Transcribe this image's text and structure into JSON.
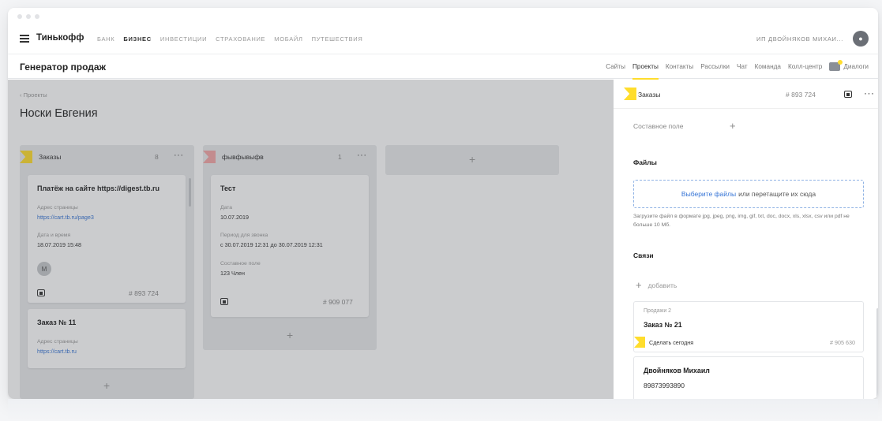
{
  "topbar": {
    "brand": "Тинькофф",
    "menu": [
      {
        "label": "БАНК",
        "active": false
      },
      {
        "label": "БИЗНЕС",
        "active": true
      },
      {
        "label": "ИНВЕСТИЦИИ",
        "active": false
      },
      {
        "label": "СТРАХОВАНИЕ",
        "active": false
      },
      {
        "label": "МОБАЙЛ",
        "active": false
      },
      {
        "label": "ПУТЕШЕСТВИЯ",
        "active": false
      }
    ],
    "account": "ИП ДВОЙНЯКОВ МИХАИ..."
  },
  "app": {
    "title": "Генератор продаж",
    "nav": [
      "Сайты",
      "Проекты",
      "Контакты",
      "Рассылки",
      "Чат",
      "Команда",
      "Колл-центр"
    ],
    "nav_active": "Проекты",
    "dialogs": "Диалоги"
  },
  "board": {
    "breadcrumb": "Проекты",
    "title": "Носки Евгения",
    "columns": [
      {
        "title": "Заказы",
        "count": "8",
        "flag_color": "#ffdd2d",
        "cards": [
          {
            "title": "Платёж на сайте https://digest.tb.ru",
            "page_label": "Адрес страницы",
            "page_url": "https://cart.tb.ru/page3",
            "date_label": "Дата и время",
            "date": "18.07.2019 15:48",
            "avatar": "М",
            "id": "# 893 724"
          },
          {
            "title": "Заказ № 11",
            "page_label": "Адрес страницы",
            "page_url": "https://cart.tb.ru"
          }
        ]
      },
      {
        "title": "фывфывыфв",
        "count": "1",
        "flag_color": "#f4a7a7",
        "cards": [
          {
            "title": "Тест",
            "date_label": "Дата",
            "date": "10.07.2019",
            "period_label": "Период для звонка",
            "period": "с 30.07.2019 12:31 до 30.07.2019 12:31",
            "field_label": "Составное поле",
            "field_value": "123 Член",
            "id": "# 909 077"
          }
        ]
      }
    ]
  },
  "panel": {
    "title": "Заказы",
    "id": "# 893 724",
    "composite_field": "Составное поле",
    "files_heading": "Файлы",
    "dropzone_link": "Выберите файлы",
    "dropzone_text": "или перетащите их сюда",
    "files_hint": "Загрузите файл в формате jpg, jpeg, png, img, gif, txt, doc, docx, xls, xlsx, csv или pdf не больше 10 Мб.",
    "links_heading": "Связи",
    "add_label": "добавить",
    "related": {
      "project": "Продажи 2",
      "title": "Заказ № 21",
      "task": "Сделать сегодня",
      "id": "# 905 630"
    },
    "contact": {
      "name": "Двойняков Михаил",
      "phone": "89873993890"
    }
  },
  "colors": {
    "accent": "#ffdd2d",
    "link": "#3574d6"
  }
}
